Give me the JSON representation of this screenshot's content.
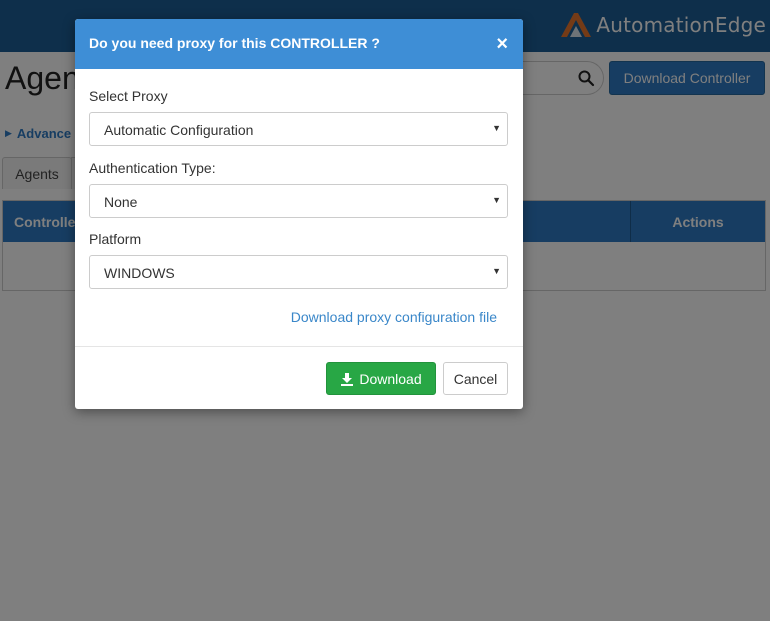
{
  "app": {
    "brand_name": "AutomationEdge",
    "page_title": "Agen",
    "download_controller_label": "Download Controller",
    "advanced_label": "Advance",
    "tabs": [
      {
        "label": "Agents"
      }
    ],
    "table": {
      "columns": [
        "Controlle",
        "Actions"
      ]
    }
  },
  "modal": {
    "title": "Do you need proxy for this CONTROLLER ?",
    "close_symbol": "×",
    "fields": [
      {
        "label": "Select Proxy",
        "value": "Automatic Configuration"
      },
      {
        "label": "Authentication Type:",
        "value": "None"
      },
      {
        "label": "Platform",
        "value": "WINDOWS"
      }
    ],
    "proxy_link": "Download proxy configuration file",
    "download_label": "Download",
    "cancel_label": "Cancel"
  },
  "colors": {
    "header_blue": "#3e8ed6",
    "nav_blue": "#1d5f96",
    "primary_button": "#2e7bc4",
    "download_green": "#28a745",
    "link": "#3a87c9",
    "brand_orange": "#e8772e"
  },
  "icons": {
    "search": "search-icon",
    "download": "download-icon",
    "close": "close-icon",
    "logo": "automationedge-logo-icon",
    "select_arrow": "caret-down-icon"
  }
}
